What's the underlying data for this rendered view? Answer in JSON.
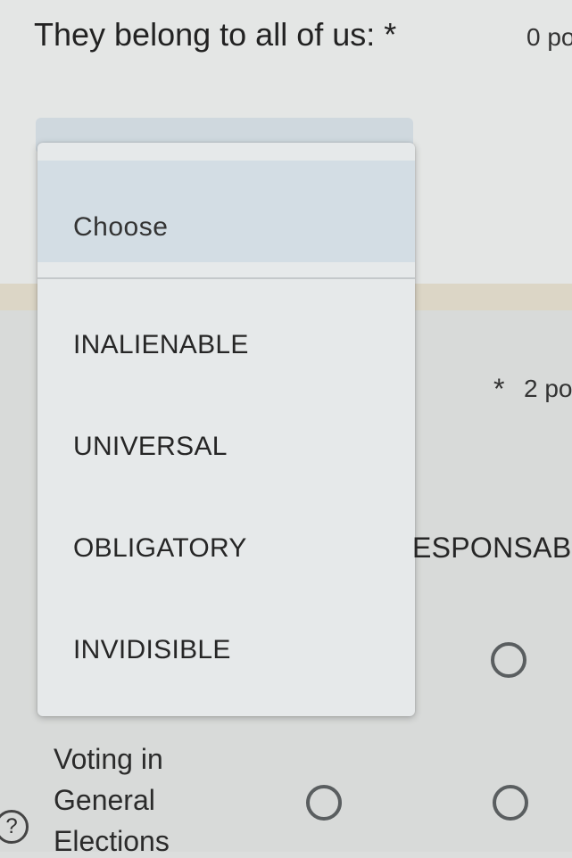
{
  "question1": {
    "title": "They belong to all of us:",
    "required_mark": "*",
    "points": "0 po"
  },
  "dropdown": {
    "placeholder": "Choose",
    "options": [
      "INALIENABLE",
      "UNIVERSAL",
      "OBLIGATORY",
      "INVIDISIBLE"
    ]
  },
  "question2": {
    "required_mark": "*",
    "points": "2 po",
    "column_header": "ESPONSABI",
    "rows": [
      {
        "label_lines": [
          "Voting in",
          "General",
          "Elections"
        ]
      }
    ]
  },
  "icons": {
    "help": "help-icon",
    "help_glyph": "?"
  }
}
